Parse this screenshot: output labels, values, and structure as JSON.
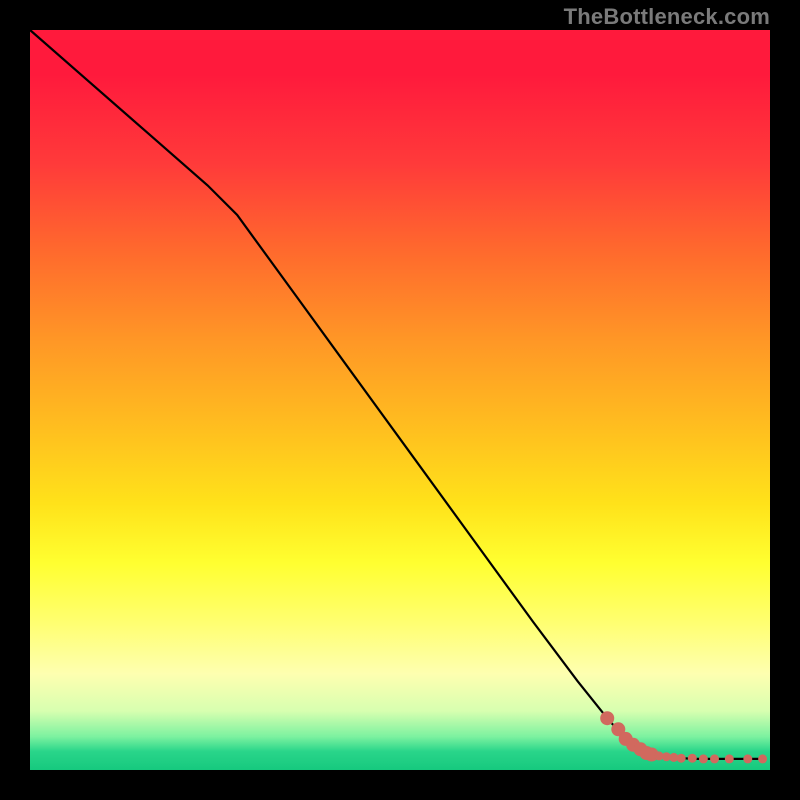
{
  "watermark": "TheBottleneck.com",
  "colors": {
    "background": "#000000",
    "curve": "#000000",
    "marker": "#d1695e",
    "gradient_top": "#ff1a3c",
    "gradient_mid": "#ffff30",
    "gradient_bottom": "#16c97e"
  },
  "chart_data": {
    "type": "line",
    "title": "",
    "xlabel": "",
    "ylabel": "",
    "xlim": [
      0,
      100
    ],
    "ylim": [
      0,
      100
    ],
    "grid": false,
    "legend": false,
    "series": [
      {
        "name": "bottleneck-curve",
        "x": [
          0,
          8,
          16,
          24,
          28,
          36,
          44,
          52,
          60,
          68,
          74,
          78,
          80.5,
          82.5,
          84,
          86,
          88,
          90,
          92,
          94,
          96,
          97,
          99
        ],
        "y": [
          100,
          93,
          86,
          79,
          75,
          64,
          53,
          42,
          31,
          20,
          12,
          7,
          4.2,
          2.8,
          2.1,
          1.8,
          1.6,
          1.5,
          1.5,
          1.5,
          1.5,
          1.5,
          1.5
        ]
      }
    ],
    "markers": {
      "name": "highlighted-points",
      "points": [
        {
          "x": 78.0,
          "y": 7.0,
          "size": "lg"
        },
        {
          "x": 79.5,
          "y": 5.5,
          "size": "lg"
        },
        {
          "x": 80.5,
          "y": 4.2,
          "size": "lg"
        },
        {
          "x": 81.5,
          "y": 3.4,
          "size": "lg"
        },
        {
          "x": 82.5,
          "y": 2.8,
          "size": "lg"
        },
        {
          "x": 83.3,
          "y": 2.3,
          "size": "lg"
        },
        {
          "x": 84.0,
          "y": 2.1,
          "size": "lg"
        },
        {
          "x": 85.0,
          "y": 1.9,
          "size": "sm"
        },
        {
          "x": 86.0,
          "y": 1.8,
          "size": "sm"
        },
        {
          "x": 87.0,
          "y": 1.7,
          "size": "sm"
        },
        {
          "x": 88.0,
          "y": 1.6,
          "size": "sm"
        },
        {
          "x": 89.5,
          "y": 1.6,
          "size": "sm"
        },
        {
          "x": 91.0,
          "y": 1.5,
          "size": "sm"
        },
        {
          "x": 92.5,
          "y": 1.5,
          "size": "sm"
        },
        {
          "x": 94.5,
          "y": 1.5,
          "size": "sm"
        },
        {
          "x": 97.0,
          "y": 1.5,
          "size": "sm"
        },
        {
          "x": 99.0,
          "y": 1.5,
          "size": "sm"
        }
      ]
    }
  }
}
